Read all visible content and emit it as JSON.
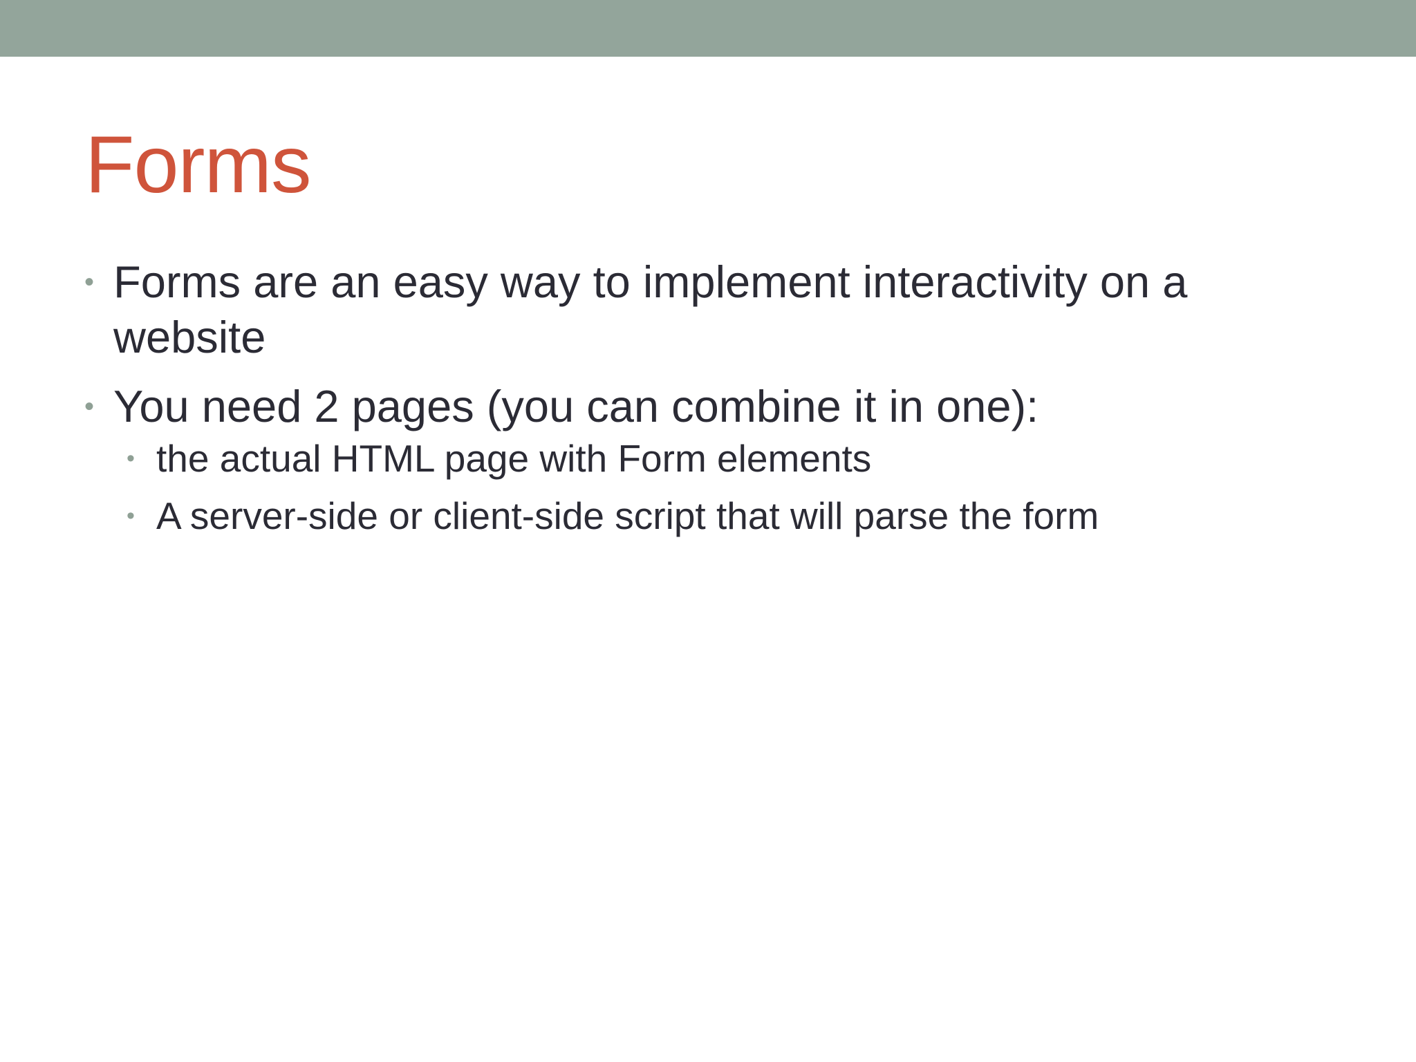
{
  "theme": {
    "band_color": "#93a59b",
    "title_color": "#cf543b",
    "text_color": "#2b2b35",
    "bullet_color": "#8fa095"
  },
  "slide": {
    "title": "Forms",
    "bullets": [
      {
        "marker": "•",
        "text": "Forms are an easy way to implement interactivity on a website"
      },
      {
        "marker": "•",
        "text": "You need 2 pages (you can combine it in one):",
        "sub": [
          {
            "marker": "•",
            "text": "the actual HTML page with Form elements"
          },
          {
            "marker": "•",
            "text": "A server-side or client-side script that will parse the form"
          }
        ]
      }
    ]
  }
}
